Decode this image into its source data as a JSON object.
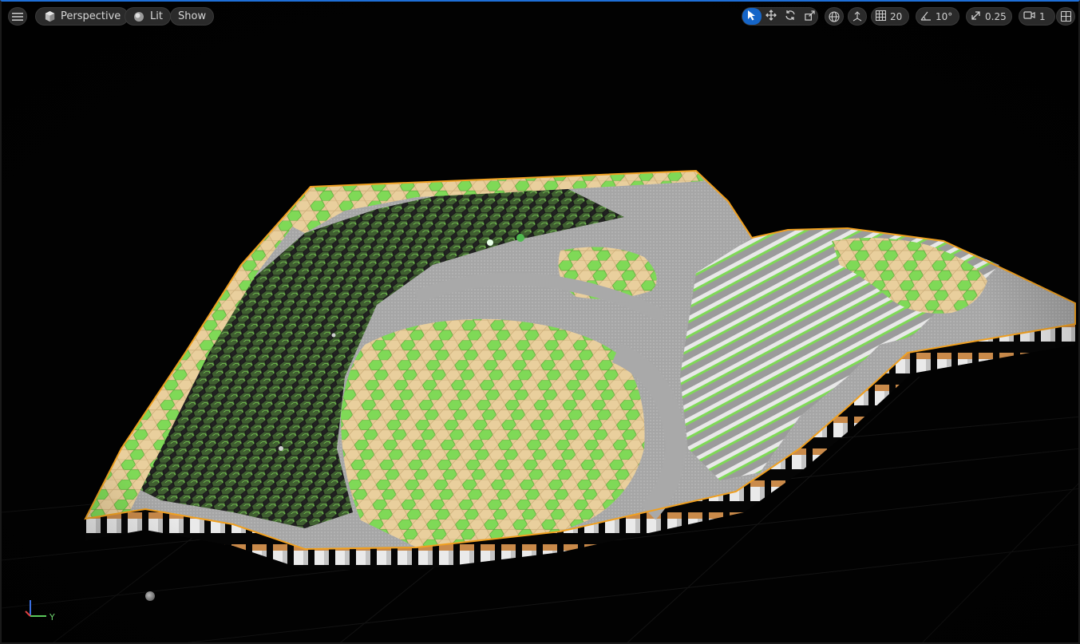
{
  "toolbar": {
    "menu_icon": "hamburger-menu-icon",
    "view_mode": {
      "label": "Perspective",
      "icon": "cube-icon"
    },
    "lighting": {
      "label": "Lit",
      "icon": "sphere-icon"
    },
    "show": {
      "label": "Show"
    },
    "transform_tools": {
      "select": "cursor-arrow-icon",
      "translate": "move-arrows-icon",
      "rotate": "rotate-icon",
      "scale": "scale-icon",
      "active": "select"
    },
    "coord_space_icon": "globe-icon",
    "surface_snap_icon": "surface-snap-icon",
    "grid_snap": {
      "icon": "grid-icon",
      "value": "20"
    },
    "rotation_snap": {
      "icon": "angle-icon",
      "value": "10°"
    },
    "scale_snap": {
      "icon": "scale-arrow-icon",
      "value": "0.25"
    },
    "camera_speed": {
      "icon": "camera-icon",
      "value": "1"
    },
    "layout_icon": "viewport-layout-icon"
  },
  "gizmo": {
    "y_label": "Y"
  },
  "colors": {
    "grass": "#7ed957",
    "sand": "#e8cc96",
    "road": "#a9a9a9",
    "outline": "#f0a020",
    "base": "#e8e8e8",
    "accent": "#1565c8"
  }
}
